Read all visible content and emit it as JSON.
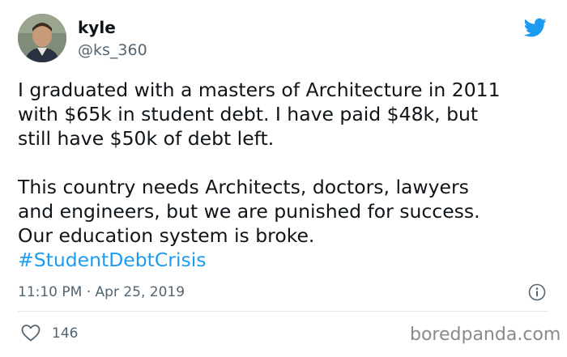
{
  "user": {
    "display_name": "kyle",
    "handle": "@ks_360"
  },
  "tweet": {
    "paragraph_1": "I graduated with a masters of Architecture in 2011\nwith $65k in student debt. I have paid $48k, but\nstill have $50k of debt left.",
    "paragraph_2": "This country needs Architects, doctors, lawyers\nand engineers, but we are punished for success.\nOur education system is broke.",
    "hashtag": "#StudentDebtCrisis",
    "timestamp": "11:10 PM · Apr 25, 2019"
  },
  "actions": {
    "like_count": "146"
  },
  "watermark": {
    "text": "boredpanda.com"
  },
  "colors": {
    "text": "#0f1419",
    "muted": "#536471",
    "link": "#1d9bf0",
    "twitter_blue": "#1d9bf0"
  },
  "icons": {
    "brand": "twitter-bird-icon",
    "info": "info-icon",
    "like": "heart-icon"
  }
}
